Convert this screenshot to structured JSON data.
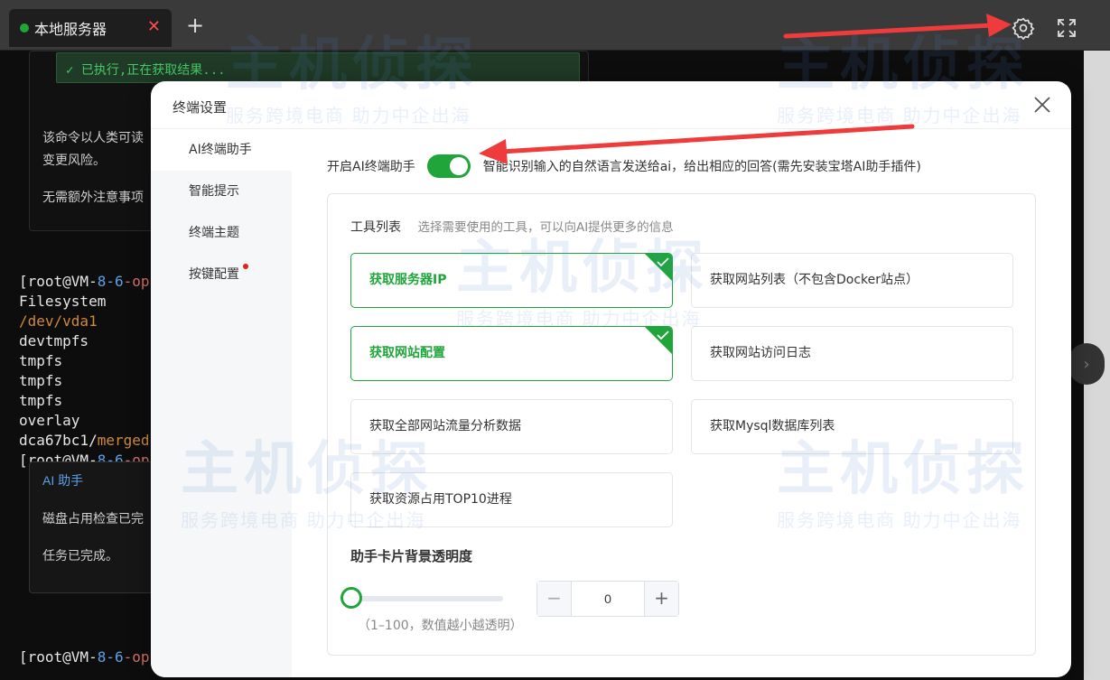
{
  "tab": {
    "title": "本地服务器",
    "close": "✕",
    "add": "+"
  },
  "terminal": {
    "exec_status": "✓ 已执行,正在获取结果...",
    "desc_line1": "该命令以人类可读",
    "desc_line2": "变更风险。",
    "desc_line3": "无需额外注意事项",
    "lines": {
      "l1_prefix": "[root@VM-",
      "l1_num": "8-6",
      "l1_rest": "-op",
      "l2": "Filesystem",
      "l3": "/dev/vda1",
      "l4": "devtmpfs",
      "l5": "tmpfs",
      "l6": "tmpfs",
      "l7": "tmpfs",
      "l8": "overlay",
      "l9_a": "dca67bc1/",
      "l9_b": "merged",
      "l10_prefix": "[root@VM-",
      "l10_num": "8-6",
      "l10_rest": "-op",
      "l11_prefix": "[root@VM-",
      "l11_num": "8-6",
      "l11_rest": "-op"
    },
    "ai_card_title": "AI 助手",
    "ai_card_line1": "磁盘占用检查已完",
    "ai_card_line2": "任务已完成。"
  },
  "modal": {
    "title": "终端设置",
    "sidebar": [
      {
        "label": "AI终端助手"
      },
      {
        "label": "智能提示"
      },
      {
        "label": "终端主题"
      },
      {
        "label": "按键配置"
      }
    ],
    "toggle_label": "开启AI终端助手",
    "toggle_on": true,
    "toggle_desc": "智能识别输入的自然语言发送给ai，给出相应的回答(需先安装宝塔AI助手插件)",
    "tools_title": "工具列表",
    "tools_subtitle": "选择需要使用的工具，可以向AI提供更多的信息",
    "tools": [
      {
        "label": "获取服务器IP",
        "selected": true
      },
      {
        "label": "获取网站列表（不包含Docker站点）",
        "selected": false
      },
      {
        "label": "获取网站配置",
        "selected": true
      },
      {
        "label": "获取网站访问日志",
        "selected": false
      },
      {
        "label": "获取全部网站流量分析数据",
        "selected": false
      },
      {
        "label": "获取Mysql数据库列表",
        "selected": false
      },
      {
        "label": "获取资源占用TOP10进程",
        "selected": false
      }
    ],
    "opacity_label": "助手卡片背景透明度",
    "opacity_value": "0",
    "opacity_hint": "（1–100，数值越小越透明）"
  },
  "watermark": {
    "big": "主机侦探",
    "small": "服务跨境电商 助力中企出海"
  },
  "colors": {
    "accent": "#20a53a",
    "arrow": "#ee3b3b"
  }
}
